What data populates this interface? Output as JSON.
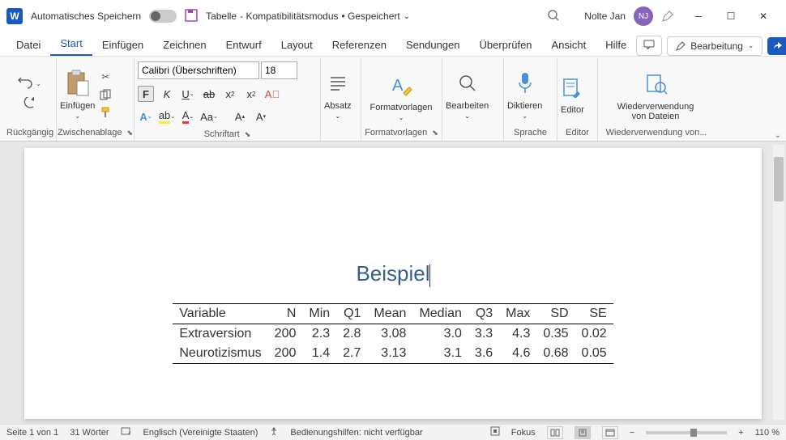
{
  "titlebar": {
    "autosave_label": "Automatisches Speichern",
    "doc_name": "Tabelle",
    "mode": " - Kompatibilitätsmodus",
    "saved": " • Gespeichert",
    "user_name": "Nolte Jan",
    "user_initials": "NJ"
  },
  "tabs": {
    "datei": "Datei",
    "start": "Start",
    "einfuegen": "Einfügen",
    "zeichnen": "Zeichnen",
    "entwurf": "Entwurf",
    "layout": "Layout",
    "referenzen": "Referenzen",
    "sendungen": "Sendungen",
    "ueberpruefen": "Überprüfen",
    "ansicht": "Ansicht",
    "hilfe": "Hilfe",
    "bearbeitung": "Bearbeitung"
  },
  "ribbon": {
    "rueckgaengig": "Rückgängig",
    "zwischenablage": "Zwischenablage",
    "einfuegen": "Einfügen",
    "schriftart": "Schriftart",
    "font_name": "Calibri (Überschriften)",
    "font_size": "18",
    "absatz": "Absatz",
    "formatvorlagen": "Formatvorlagen",
    "bearbeiten": "Bearbeiten",
    "diktieren": "Diktieren",
    "sprache": "Sprache",
    "editor": "Editor",
    "wiederverwendung": "Wiederverwendung\nvon Dateien",
    "wiederverwendung_label": "Wiederverwendung von..."
  },
  "document": {
    "title": "Beispiel",
    "headers": [
      "Variable",
      "N",
      "Min",
      "Q1",
      "Mean",
      "Median",
      "Q3",
      "Max",
      "SD",
      "SE"
    ],
    "rows": [
      {
        "var": "Extraversion",
        "n": "200",
        "min": "2.3",
        "q1": "2.8",
        "mean": "3.08",
        "median": "3.0",
        "q3": "3.3",
        "max": "4.3",
        "sd": "0.35",
        "se": "0.02"
      },
      {
        "var": "Neurotizismus",
        "n": "200",
        "min": "1.4",
        "q1": "2.7",
        "mean": "3.13",
        "median": "3.1",
        "q3": "3.6",
        "max": "4.6",
        "sd": "0.68",
        "se": "0.05"
      }
    ]
  },
  "statusbar": {
    "page": "Seite 1 von 1",
    "words": "31 Wörter",
    "language": "Englisch (Vereinigte Staaten)",
    "accessibility": "Bedienungshilfen: nicht verfügbar",
    "focus": "Fokus",
    "zoom": "110 %"
  },
  "chart_data": {
    "type": "table",
    "title": "Beispiel",
    "columns": [
      "Variable",
      "N",
      "Min",
      "Q1",
      "Mean",
      "Median",
      "Q3",
      "Max",
      "SD",
      "SE"
    ],
    "rows": [
      [
        "Extraversion",
        200,
        2.3,
        2.8,
        3.08,
        3.0,
        3.3,
        4.3,
        0.35,
        0.02
      ],
      [
        "Neurotizismus",
        200,
        1.4,
        2.7,
        3.13,
        3.1,
        3.6,
        4.6,
        0.68,
        0.05
      ]
    ]
  }
}
